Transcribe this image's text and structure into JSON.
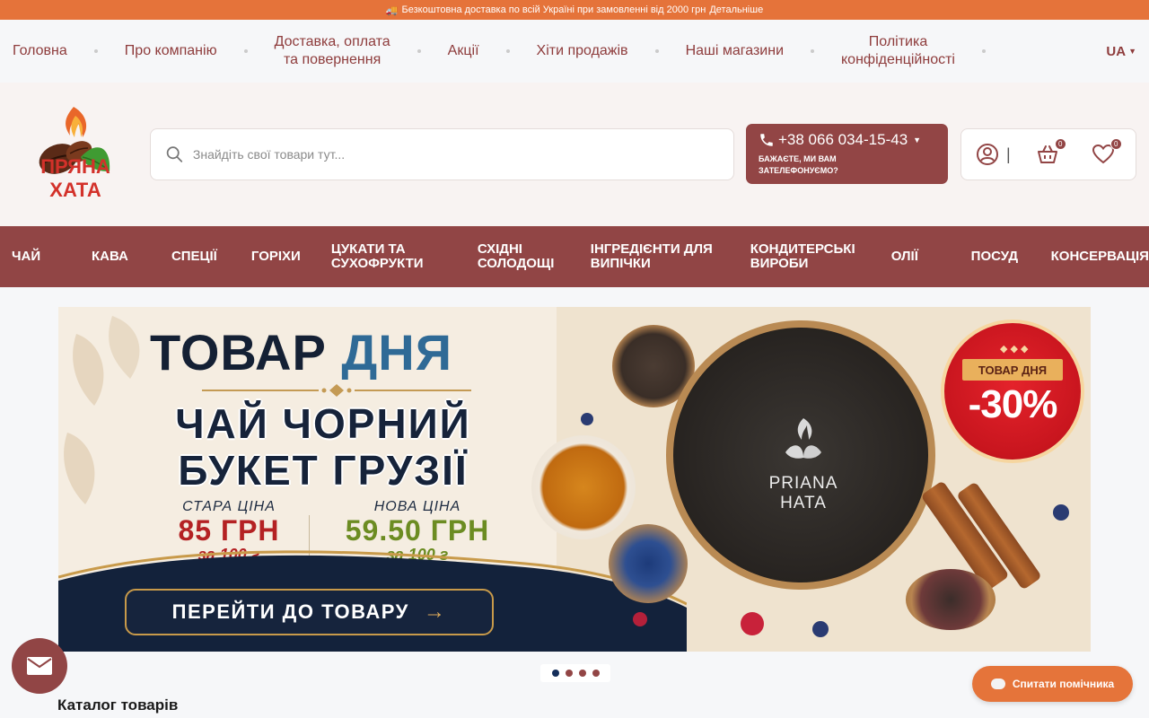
{
  "promo": {
    "text": "Безкоштовна доставка по всій Україні при замовленні від 2000 грн",
    "link": "Детальніше"
  },
  "topnav": {
    "items": [
      {
        "label": "Головна"
      },
      {
        "label": "Про компанію"
      },
      {
        "label_line1": "Доставка, оплата",
        "label_line2": "та повернення"
      },
      {
        "label": "Акції"
      },
      {
        "label": "Хіти продажів"
      },
      {
        "label": "Наші магазини"
      },
      {
        "label_line1": "Політика",
        "label_line2": "конфіденційності"
      }
    ],
    "lang": "UA"
  },
  "header": {
    "logo_text": "ПРЯНА ХАТА",
    "search_placeholder": "Знайдіть свої товари тут...",
    "phone": "+38 066 034-15-43",
    "callback_text": "Бажаєте, ми вам зателефонуємо?",
    "cart_count": "0",
    "wishlist_count": "0"
  },
  "categories": [
    "Чай",
    "Кава",
    "Спеції",
    "Горіхи",
    "Цукати та сухофрукти",
    "Східні солодощі",
    "Інгредієнти для випічки",
    "Кондитерські вироби",
    "Олії",
    "Посуд",
    "Консервація"
  ],
  "banner": {
    "title_word1": "ТОВАР",
    "title_word2": "ДНЯ",
    "product_line1": "ЧАЙ ЧОРНИЙ",
    "product_line2": "БУКЕТ ГРУЗІЇ",
    "old_price_label": "СТАРА ЦІНА",
    "old_price": "85 ГРН",
    "old_price_unit": "за 100 г",
    "new_price_label": "НОВА ЦІНА",
    "new_price": "59.50 ГРН",
    "new_price_unit": "за 100 г",
    "cta": "ПЕРЕЙТИ ДО ТОВАРУ",
    "product_brand": "PRIANA HATA",
    "deal_ribbon": "ТОВАР ДНЯ",
    "discount": "-30%"
  },
  "slider": {
    "count": 4,
    "active": 0
  },
  "catalog_title": "Каталог товарів",
  "assistant_label": "Спитати помічника",
  "colors": {
    "accent_orange": "#e5733a",
    "brand_maroon": "#914545",
    "navy": "#16243d"
  }
}
